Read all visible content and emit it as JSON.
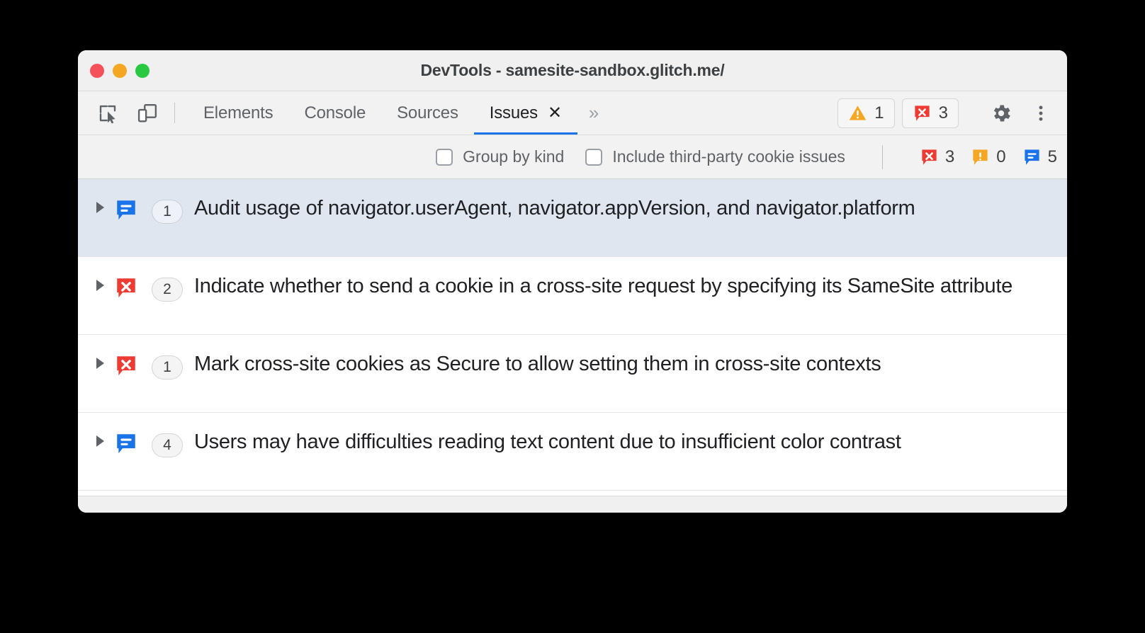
{
  "window": {
    "title": "DevTools - samesite-sandbox.glitch.me/",
    "traffic_lights": [
      {
        "name": "close",
        "color": "#f4515b"
      },
      {
        "name": "minimize",
        "color": "#f5a623"
      },
      {
        "name": "zoom",
        "color": "#28c840"
      }
    ]
  },
  "toolbar": {
    "inspect_icon": "inspect-element-icon",
    "device_icon": "device-toolbar-icon",
    "gear_icon": "gear-icon",
    "more_icon": "more-vertical-icon",
    "overflow_label": "»",
    "close_tab_label": "✕",
    "warning_count": "1",
    "error_count": "3"
  },
  "tabs": [
    {
      "label": "Elements",
      "active": false
    },
    {
      "label": "Console",
      "active": false
    },
    {
      "label": "Sources",
      "active": false
    },
    {
      "label": "Issues",
      "active": true
    }
  ],
  "filters": {
    "group_by_kind": {
      "label": "Group by kind",
      "checked": false
    },
    "include_third_party": {
      "label": "Include third-party cookie issues",
      "checked": false
    },
    "counts": {
      "errors": "3",
      "warnings": "0",
      "info": "5"
    }
  },
  "issues": [
    {
      "kind": "info",
      "count": "1",
      "text": "Audit usage of navigator.userAgent, navigator.appVersion, and navigator.platform",
      "selected": true
    },
    {
      "kind": "error",
      "count": "2",
      "text": "Indicate whether to send a cookie in a cross-site request by specifying its SameSite attribute",
      "selected": false
    },
    {
      "kind": "error",
      "count": "1",
      "text": "Mark cross-site cookies as Secure to allow setting them in cross-site contexts",
      "selected": false
    },
    {
      "kind": "info",
      "count": "4",
      "text": "Users may have difficulties reading text content due to insufficient color contrast",
      "selected": false
    }
  ],
  "colors": {
    "error_red": "#ee3b33",
    "warning_orange": "#f5a623",
    "info_blue": "#1a73e8",
    "accent_blue": "#1a73e8",
    "selected_row": "#dfe6f0"
  }
}
